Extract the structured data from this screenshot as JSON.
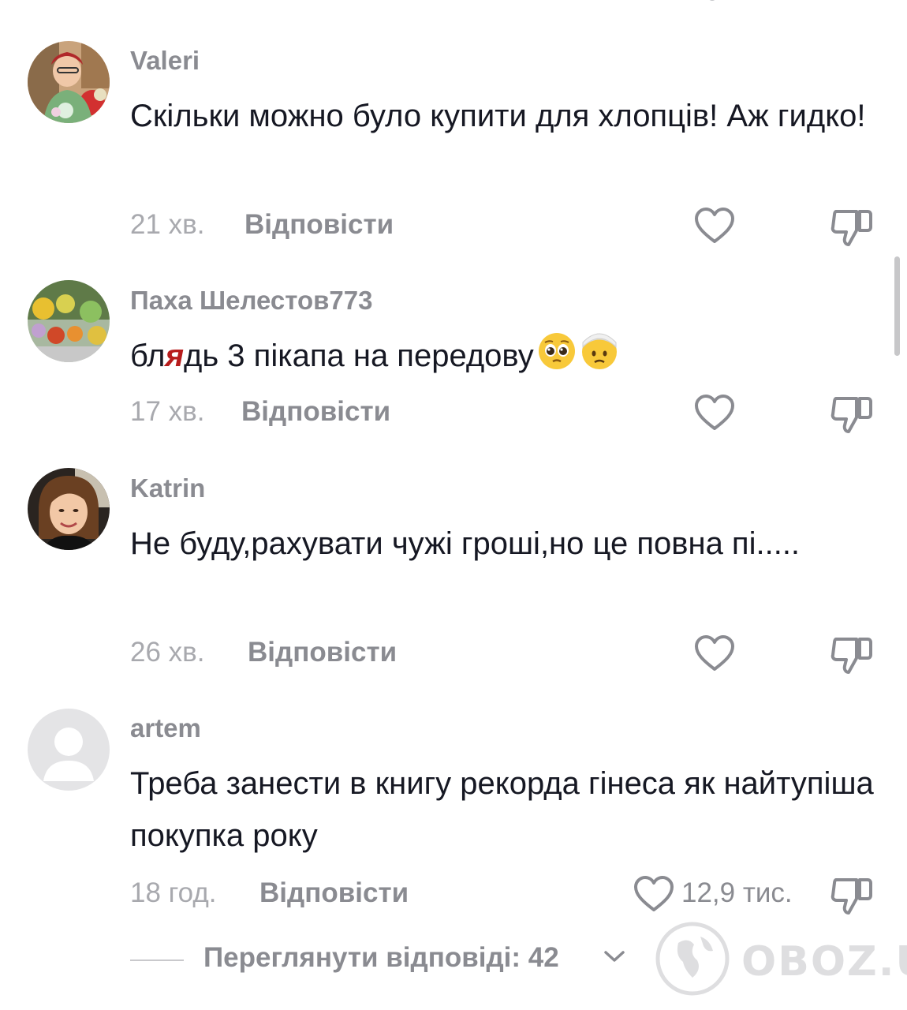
{
  "comments": [
    {
      "username": "Valeri",
      "text": "Скільки можно було купити для хлопців! Аж гидко!",
      "time": "21 хв.",
      "reply_label": "Відповісти"
    },
    {
      "username": "Паха Шелестов773",
      "text_before": "бл",
      "text_censored": "я",
      "text_after": "дь 3 пікапа на передову",
      "emojis": [
        "pleading-face-emoji",
        "face-with-head-bandage-emoji"
      ],
      "time": "17 хв.",
      "reply_label": "Відповісти"
    },
    {
      "username": "Katrin",
      "text": "Не буду,рахувати чужі гроші,но це повна пі.....",
      "time": "26 хв.",
      "reply_label": "Відповісти"
    },
    {
      "username": "artem",
      "text": "Треба занести в книгу рекорда гінеса як найтупіша покупка року",
      "time": "18 год.",
      "reply_label": "Відповісти",
      "like_count": "12,9 тис."
    }
  ],
  "view_replies_label": "Переглянути відповіді: 42",
  "watermark": "OBOZ.UA",
  "icons": {
    "like": "heart-outline-icon",
    "dislike": "thumbs-down-outline-icon",
    "expand": "chevron-down-icon"
  },
  "colors": {
    "username": "#8a8b91",
    "text": "#161823",
    "meta": "#a8a9ae",
    "censor": "#b71c1c"
  }
}
